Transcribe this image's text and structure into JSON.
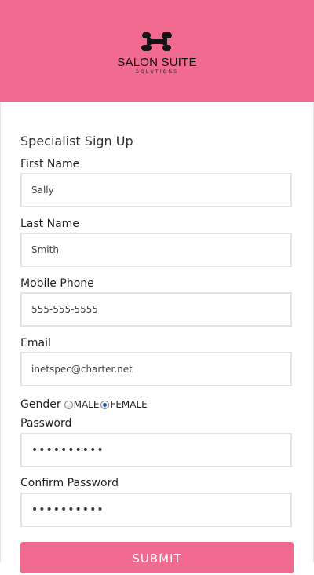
{
  "brand": {
    "name": "SALON SUITE",
    "tagline": "SOLUTIONS",
    "header_color": "#f06b8f",
    "logo_icon": "salon-suite-logo-icon"
  },
  "form": {
    "title": "Specialist Sign Up",
    "first_name": {
      "label": "First Name",
      "value": "Sally"
    },
    "last_name": {
      "label": "Last Name",
      "value": "Smith"
    },
    "mobile_phone": {
      "label": "Mobile Phone",
      "value": "555-555-5555"
    },
    "email": {
      "label": "Email",
      "value": "inetspec@charter.net"
    },
    "gender": {
      "label": "Gender",
      "options": [
        "MALE",
        "FEMALE"
      ],
      "selected": "FEMALE"
    },
    "password": {
      "label": "Password",
      "value": "••••••••••"
    },
    "confirm_password": {
      "label": "Confirm Password",
      "value": "••••••••••"
    },
    "submit_label": "SUBMIT"
  }
}
